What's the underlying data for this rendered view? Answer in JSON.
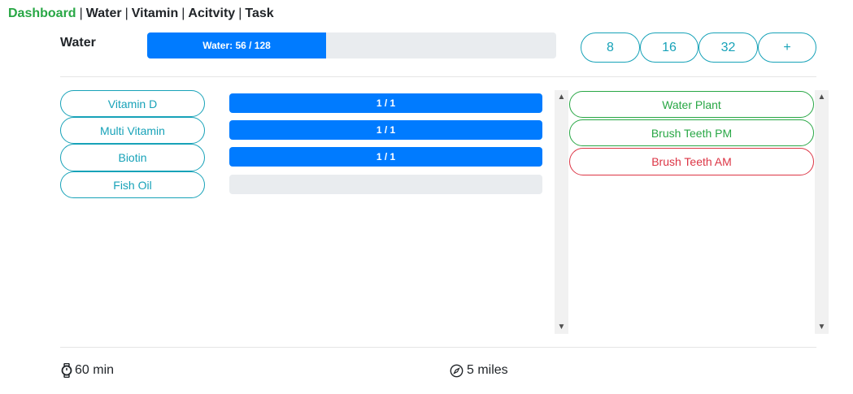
{
  "nav": {
    "items": [
      "Dashboard",
      "Water",
      "Vitamin",
      "Acitvity",
      "Task"
    ],
    "separator": "|"
  },
  "water": {
    "label": "Water",
    "progress_text": "Water: 56 / 128",
    "current": 56,
    "goal": 128,
    "progress_fraction": 0.4375,
    "buttons": [
      "8",
      "16",
      "32",
      "+"
    ]
  },
  "vitamins": [
    {
      "name": "Vitamin D",
      "progress_text": "1 / 1",
      "fraction": 1
    },
    {
      "name": "Multi Vitamin",
      "progress_text": "1 / 1",
      "fraction": 1
    },
    {
      "name": "Biotin",
      "progress_text": "1 / 1",
      "fraction": 1
    },
    {
      "name": "Fish Oil",
      "progress_text": "",
      "fraction": 0
    }
  ],
  "tasks": [
    {
      "name": "Water Plant",
      "status": "done"
    },
    {
      "name": "Brush Teeth PM",
      "status": "done"
    },
    {
      "name": "Brush Teeth AM",
      "status": "pending"
    }
  ],
  "footer": {
    "activity_time": "60 min",
    "activity_distance": "5 miles"
  },
  "colors": {
    "primary": "#007bff",
    "success": "#28a745",
    "danger": "#dc3545",
    "info": "#17a2b8",
    "track": "#e9ecef"
  },
  "icons": {
    "time": "stopwatch-icon",
    "distance": "compass-icon"
  }
}
